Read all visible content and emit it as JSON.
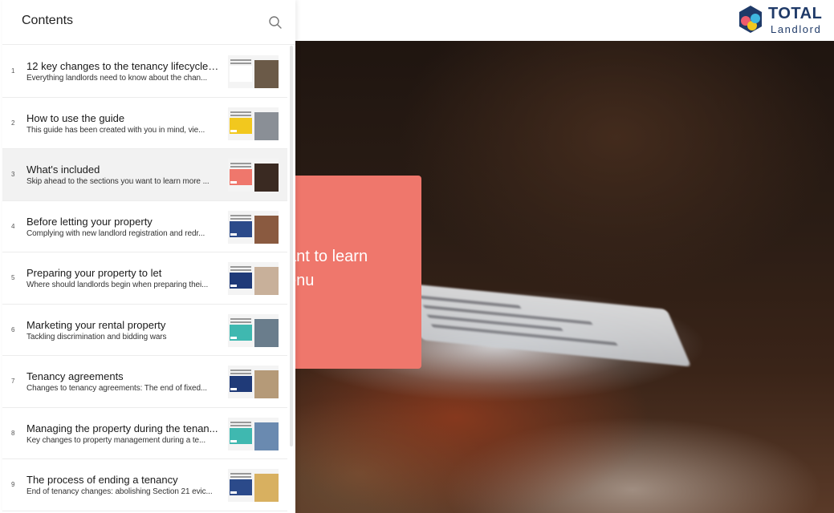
{
  "sidebar": {
    "title": "Contents",
    "items": [
      {
        "num": "1",
        "title": "12 key changes to the tenancy lifecycle ...",
        "subtitle": "Everything landlords need to know about the chan...",
        "active": false,
        "accent": "#ffffff",
        "photo": "#6b5a48"
      },
      {
        "num": "2",
        "title": "How to use the guide",
        "subtitle": "This guide has been created with you in mind, vie...",
        "active": false,
        "accent": "#f2c81e",
        "photo": "#8a8f96"
      },
      {
        "num": "3",
        "title": "What's included",
        "subtitle": "Skip ahead to the sections you want to learn more ...",
        "active": true,
        "accent": "#ef776c",
        "photo": "#3a2a22"
      },
      {
        "num": "4",
        "title": "Before letting your property",
        "subtitle": "Complying with new landlord registration and redr...",
        "active": false,
        "accent": "#2b4a8a",
        "photo": "#8a5a40"
      },
      {
        "num": "5",
        "title": "Preparing your property to let",
        "subtitle": "Where should landlords begin when preparing thei...",
        "active": false,
        "accent": "#1f3a78",
        "photo": "#c8b09a"
      },
      {
        "num": "6",
        "title": "Marketing your rental property",
        "subtitle": "Tackling discrimination and bidding wars",
        "active": false,
        "accent": "#3fb8b0",
        "photo": "#6a7d8c"
      },
      {
        "num": "7",
        "title": "Tenancy agreements",
        "subtitle": "Changes to tenancy agreements: The end of fixed...",
        "active": false,
        "accent": "#1f3a78",
        "photo": "#b59a78"
      },
      {
        "num": "8",
        "title": "Managing the property during the tenan...",
        "subtitle": "Key changes to property management during a te...",
        "active": false,
        "accent": "#3fb8b0",
        "photo": "#6a8ab0"
      },
      {
        "num": "9",
        "title": "The process of ending a tenancy",
        "subtitle": "End of tenancy changes: abolishing Section 21 evic...",
        "active": false,
        "accent": "#2b4a8a",
        "photo": "#d8b060"
      }
    ]
  },
  "hero": {
    "line1": "ant to learn",
    "line2": "enu",
    "card_color": "#ef776c"
  },
  "logo": {
    "word1": "TOTAL",
    "word2": "Landlord",
    "brand_color": "#1f3a68"
  }
}
